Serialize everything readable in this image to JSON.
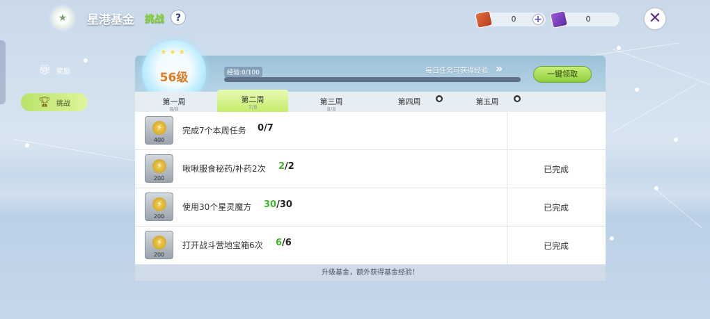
{
  "header": {
    "title": "星港基金",
    "subtitle": "挑战",
    "help": "?",
    "currency1": "0",
    "currency2": "0",
    "plus": "+",
    "close": "✕"
  },
  "sidebar": {
    "items": [
      {
        "label": "奖励",
        "icon": "gift-icon"
      },
      {
        "label": "挑战",
        "icon": "trophy-icon"
      }
    ]
  },
  "panel": {
    "level": "56级",
    "exp_label": "经验:0/100",
    "exp_progress": 0.0,
    "daily_text": "每日任务可获得经验",
    "claim_all": "一键领取",
    "tabs": [
      {
        "label": "第一周",
        "count": "8/8",
        "locked": false
      },
      {
        "label": "第二周",
        "count": "7/8",
        "locked": false,
        "active": true
      },
      {
        "label": "第三周",
        "count": "8/8",
        "locked": false
      },
      {
        "label": "第四周",
        "count": "",
        "locked": true
      },
      {
        "label": "第五周",
        "count": "",
        "locked": true
      }
    ],
    "tasks": [
      {
        "reward": "400",
        "text": "完成7个本周任务",
        "done": "0",
        "total": "7",
        "status": ""
      },
      {
        "reward": "200",
        "text": "啾啾服食秘药/补药2次",
        "done": "2",
        "total": "2",
        "status": "已完成"
      },
      {
        "reward": "200",
        "text": "使用30个星灵魔方",
        "done": "30",
        "total": "30",
        "status": "已完成"
      },
      {
        "reward": "200",
        "text": "打开战斗营地宝箱6次",
        "done": "6",
        "total": "6",
        "status": "已完成"
      }
    ],
    "footer": "升级基金，额外获得基金经验！"
  },
  "colors": {
    "accent_green": "#3fb72b",
    "level_orange": "#e07a20",
    "claim_green": "#8fcf3c"
  }
}
